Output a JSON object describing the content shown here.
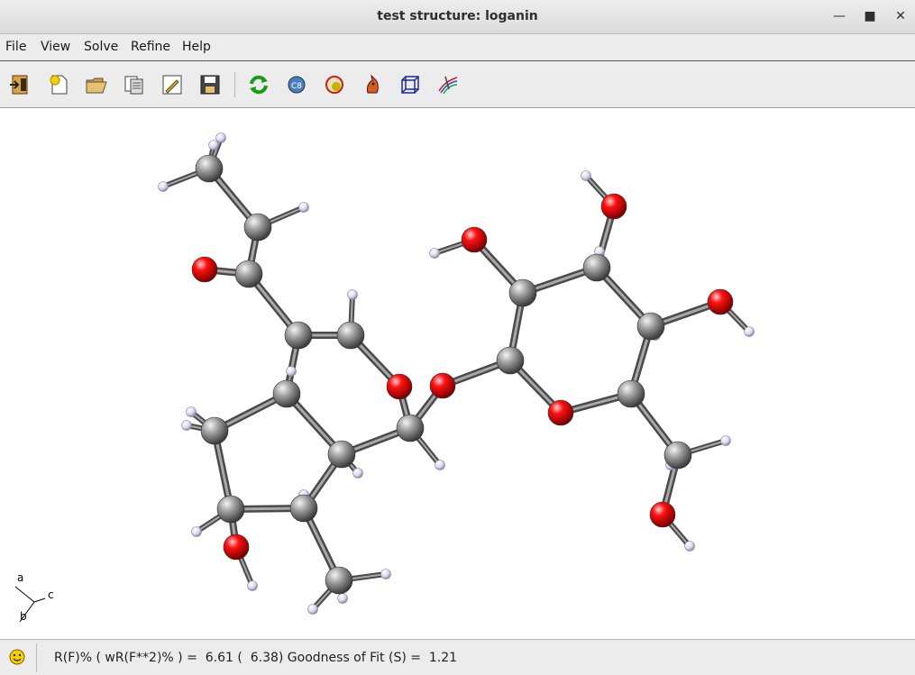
{
  "window": {
    "title": "test structure: loganin"
  },
  "menu": [
    "File",
    "View",
    "Solve",
    "Refine",
    "Help"
  ],
  "toolbar": {
    "icons": [
      "exit-icon",
      "new-icon",
      "open-folder-icon",
      "structure-info-icon",
      "edit-icon",
      "save-icon",
      "refresh-icon",
      "c8-icon",
      "atom-select-icon",
      "fox-icon",
      "unit-cell-icon",
      "symmetry-icon"
    ]
  },
  "axes": {
    "a": "a",
    "b": "b",
    "c": "c"
  },
  "status": {
    "text": "R(F)% ( wR(F**2)% ) =  6.61 (  6.38) Goodness of Fit (S) =  1.21"
  },
  "colors": {
    "carbon": "#808080",
    "oxygen": "#e00000",
    "hydrogen": "#dcdcf0",
    "bond": "#7a7a7a"
  }
}
